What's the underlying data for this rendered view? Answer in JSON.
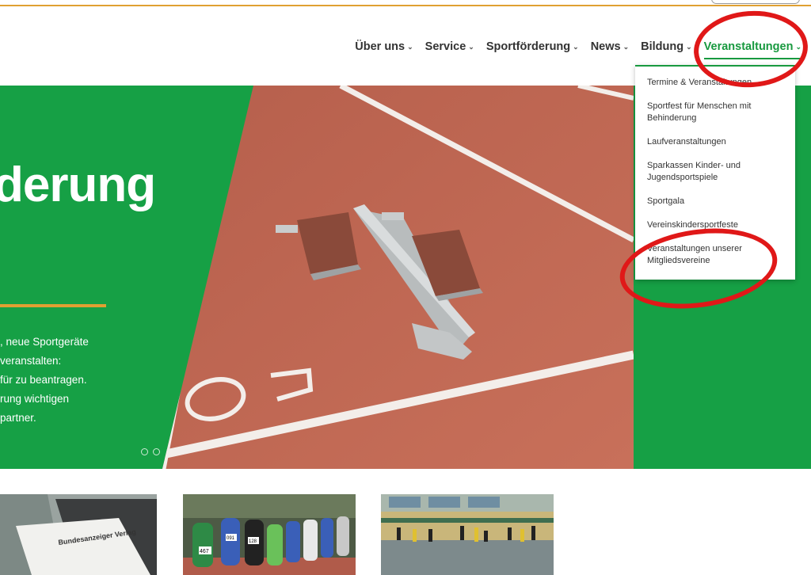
{
  "nav": {
    "items": [
      {
        "label": "Über uns"
      },
      {
        "label": "Service"
      },
      {
        "label": "Sportförderung"
      },
      {
        "label": "News"
      },
      {
        "label": "Bildung"
      },
      {
        "label": "Veranstaltungen",
        "active": true
      }
    ],
    "chevron": "⌄"
  },
  "hero": {
    "title": "derung",
    "lines": [
      ", neue Sportgeräte",
      "veranstalten:",
      "für zu beantragen.",
      "rung wichtigen",
      "partner."
    ],
    "slide_count": 2,
    "image": "running-track-starting-block"
  },
  "dropdown": {
    "items": [
      "Termine & Veranstaltungen",
      "Sportfest für Menschen mit Behinderung",
      "Laufveranstaltungen",
      "Sparkassen Kinder- und Jugendsportspiele",
      "Sportgala",
      "Vereinskindersportfeste",
      "Veranstaltungen unserer Mitgliedsvereine"
    ]
  },
  "cards": [
    {
      "image": "bundesanzeiger-document",
      "text": "Bundesanzeiger Verlag"
    },
    {
      "image": "running-race-photo",
      "bibs": [
        "467",
        "091",
        "128"
      ]
    },
    {
      "image": "sports-hall-photo"
    }
  ],
  "colors": {
    "brand_green": "#18993f",
    "accent_orange": "#e0a032",
    "annotation_red": "#e01818"
  }
}
